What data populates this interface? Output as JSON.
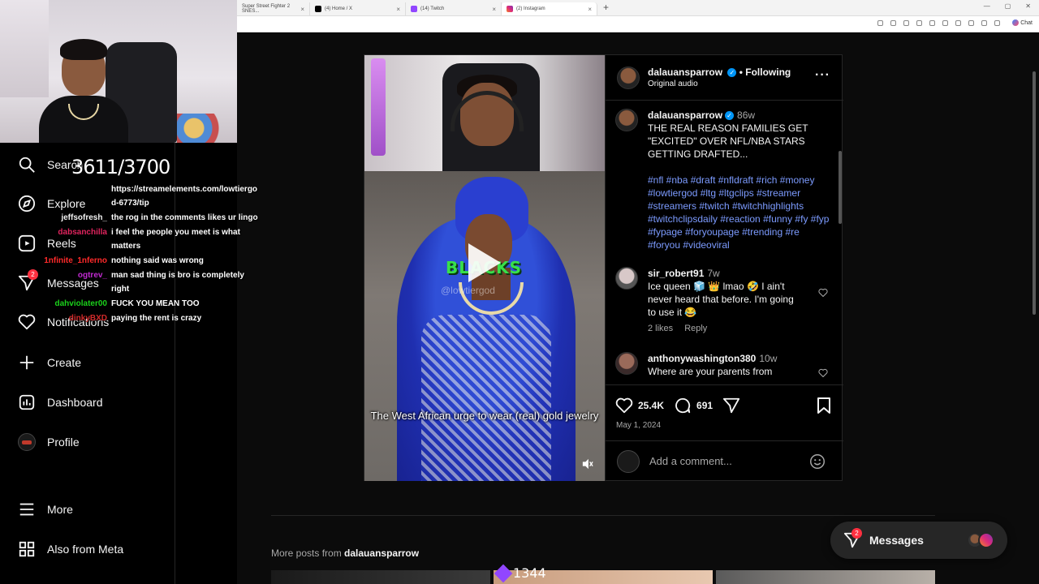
{
  "browser": {
    "tabs": [
      {
        "title": "Super Street Fighter 2 SNES..."
      },
      {
        "title": "(4) Home / X"
      },
      {
        "title": "(14) Twitch"
      },
      {
        "title": "(2) Instagram"
      }
    ],
    "new_tab": "+",
    "chat_label": "Chat"
  },
  "overlay": {
    "counter": "3611/3700",
    "chat": [
      {
        "user": "",
        "msg": "https://streamelements.com/lowtiergo",
        "color": "#ffffff"
      },
      {
        "user": "",
        "msg": "d-6773/tip",
        "color": "#ffffff"
      },
      {
        "user": "jeffsofresh_",
        "msg": "the rog in the comments likes ur lingo",
        "color": "#f2f2f2"
      },
      {
        "user": "dabsanchilla",
        "msg": "i feel the people you meet is what",
        "color": "#e0245e"
      },
      {
        "user": "",
        "msg": "matters",
        "color": "#ffffff"
      },
      {
        "user": "1nfinite_1nferno",
        "msg": "nothing said was wrong",
        "color": "#ff2a2a"
      },
      {
        "user": "ogtrev_",
        "msg": "man sad thing is bro is completely",
        "color": "#c02ad0"
      },
      {
        "user": "",
        "msg": "right",
        "color": "#ffffff"
      },
      {
        "user": "dahviolater00",
        "msg": "FUCK YOU MEAN TOO",
        "color": "#1bd11b"
      },
      {
        "user": "dinkyBXD",
        "msg": "paying the rent is crazy",
        "color": "#d12a2a"
      }
    ],
    "bits_count": "1344"
  },
  "nav": {
    "search": "Search",
    "explore": "Explore",
    "reels": "Reels",
    "messages": "Messages",
    "messages_badge": "2",
    "notifications": "Notifications",
    "create": "Create",
    "dashboard": "Dashboard",
    "profile": "Profile",
    "more": "More",
    "also_from_meta": "Also from Meta"
  },
  "post": {
    "username": "dalauansparrow",
    "follow_state": "• Following",
    "audio": "Original audio",
    "caption_time": "86w",
    "caption": "THE REAL REASON FAMILIES GET \"EXCITED\" OVER NFL/NBA STARS GETTING DRAFTED...",
    "hashtags": "#nfl #nba #draft #nfldraft #rich #money #lowtiergod #ltg #ltgclips #streamer #streamers #twitch #twitchhighlights #twitchclipsdaily #reaction #funny #fy #fyp #fypage #foryoupage #trending #re #foryou #videoviral",
    "video_caption_green": "BLACKS",
    "video_watermark": "@lowtiergod",
    "video_subtitle": "The West African urge to wear (real) gold jewelry",
    "likes": "25.4K",
    "comments_count": "691",
    "date": "May 1, 2024",
    "comment_placeholder": "Add a comment...",
    "comments": [
      {
        "user": "sir_robert91",
        "time": "7w",
        "text": "Ice queen 🧊 👑 lmao 🤣 I ain't never heard that before. I'm going to use it 😂",
        "likes": "2 likes",
        "reply": "Reply"
      },
      {
        "user": "anthonywashington380",
        "time": "10w",
        "text": "Where are your parents from"
      }
    ]
  },
  "bottom": {
    "more_posts_prefix": "More posts from",
    "more_posts_user": "dalauansparrow",
    "messages_label": "Messages",
    "messages_badge": "2"
  },
  "colors": {
    "background": "#000000",
    "accent_blue": "#0095f6",
    "hashtag": "#7c9bff",
    "badge_red": "#ff3040"
  }
}
